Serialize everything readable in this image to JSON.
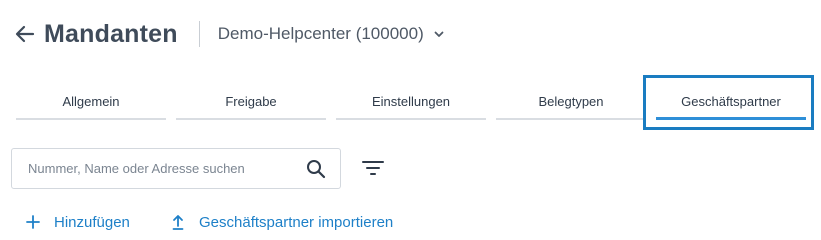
{
  "header": {
    "title": "Mandanten",
    "tenant_selector": "Demo-Helpcenter (100000)"
  },
  "tabs": [
    {
      "label": "Allgemein",
      "active": false
    },
    {
      "label": "Freigabe",
      "active": false
    },
    {
      "label": "Einstellungen",
      "active": false
    },
    {
      "label": "Belegtypen",
      "active": false
    },
    {
      "label": "Geschäftspartner",
      "active": true
    }
  ],
  "search": {
    "placeholder": "Nummer, Name oder Adresse suchen",
    "value": ""
  },
  "actions": {
    "add_label": "Hinzufügen",
    "import_label": "Geschäftspartner importieren"
  },
  "colors": {
    "accent": "#2e8fd8",
    "highlight_box": "#1a7cc1",
    "link": "#1e80c8",
    "title": "#3f4b5a"
  },
  "icons": {
    "back": "arrow-left-icon",
    "chevron": "chevron-down-icon",
    "search": "search-icon",
    "filter": "filter-icon",
    "add": "plus-icon",
    "import": "upload-icon"
  }
}
